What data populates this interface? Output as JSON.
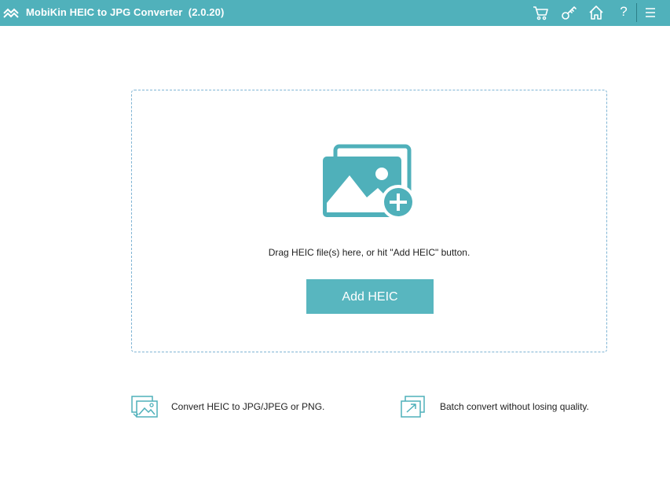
{
  "window": {
    "title": "MobiKin HEIC to JPG Converter  (2.0.20)",
    "toolbar_icons": [
      "cart-icon",
      "key-icon",
      "home-icon",
      "help-icon",
      "menu-icon"
    ],
    "help_label": "?"
  },
  "drop_zone": {
    "icon": "add-image-icon",
    "hint": "Drag HEIC file(s) here, or hit \"Add HEIC\" button.",
    "button_label": "Add HEIC"
  },
  "features": [
    {
      "icon": "convert-images-icon",
      "text": "Convert HEIC to JPG/JPEG or PNG."
    },
    {
      "icon": "batch-export-icon",
      "text": "Batch convert without losing quality."
    }
  ],
  "colors": {
    "accent": "#50b1bb",
    "button": "#58b6bf",
    "dashed_border": "#7fb4d4"
  }
}
